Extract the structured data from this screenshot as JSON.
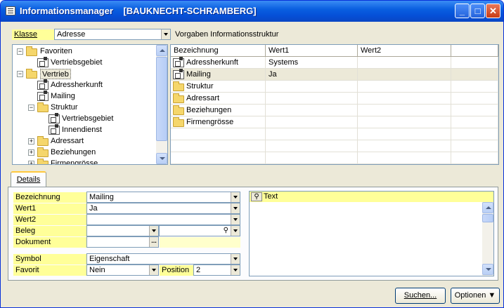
{
  "window": {
    "title": "Informationsmanager",
    "subtitle": "[BAUKNECHT-SCHRAMBERG]",
    "min": "_",
    "max": "□",
    "close": "✕"
  },
  "klasse": {
    "label": "Klasse",
    "value": "Adresse",
    "vorgaben": "Vorgaben Informationsstruktur"
  },
  "tree": {
    "favoriten": "Favoriten",
    "fav_vertriebsgebiet": "Vertriebsgebiet",
    "vertrieb": "Vertrieb",
    "adressherkunft": "Adressherkunft",
    "mailing": "Mailing",
    "struktur": "Struktur",
    "st_vertriebsgebiet": "Vertriebsgebiet",
    "innendienst": "Innendienst",
    "adressart": "Adressart",
    "beziehungen": "Beziehungen",
    "firmengroesse": "Firmengrösse"
  },
  "grid": {
    "headers": [
      "Bezeichnung",
      "Wert1",
      "Wert2"
    ],
    "rows": [
      {
        "name": "Adressherkunft",
        "wert1": "Systems",
        "wert2": "",
        "icon": "property-icon"
      },
      {
        "name": "Mailing",
        "wert1": "Ja",
        "wert2": "",
        "icon": "property-icon"
      },
      {
        "name": "Struktur",
        "wert1": "",
        "wert2": "",
        "icon": "folder-icon"
      },
      {
        "name": "Adressart",
        "wert1": "",
        "wert2": "",
        "icon": "folder-icon"
      },
      {
        "name": "Beziehungen",
        "wert1": "",
        "wert2": "",
        "icon": "folder-icon"
      },
      {
        "name": "Firmengrösse",
        "wert1": "",
        "wert2": "",
        "icon": "folder-icon"
      }
    ]
  },
  "tab": {
    "details": "Details"
  },
  "details": {
    "bezeichnung_label": "Bezeichnung",
    "bezeichnung_value": "Mailing",
    "wert1_label": "Wert1",
    "wert1_value": "Ja",
    "wert2_label": "Wert2",
    "wert2_value": "",
    "beleg_label": "Beleg",
    "beleg_value": "",
    "dokument_label": "Dokument",
    "dokument_value": "",
    "dokument_btn": "...",
    "symbol_label": "Symbol",
    "symbol_value": "Eigenschaft",
    "favorit_label": "Favorit",
    "favorit_value": "Nein",
    "position_label": "Position",
    "position_value": "2"
  },
  "text_panel": {
    "header": "Text"
  },
  "buttons": {
    "suchen": "Suchen...",
    "optionen": "Optionen ▼"
  }
}
